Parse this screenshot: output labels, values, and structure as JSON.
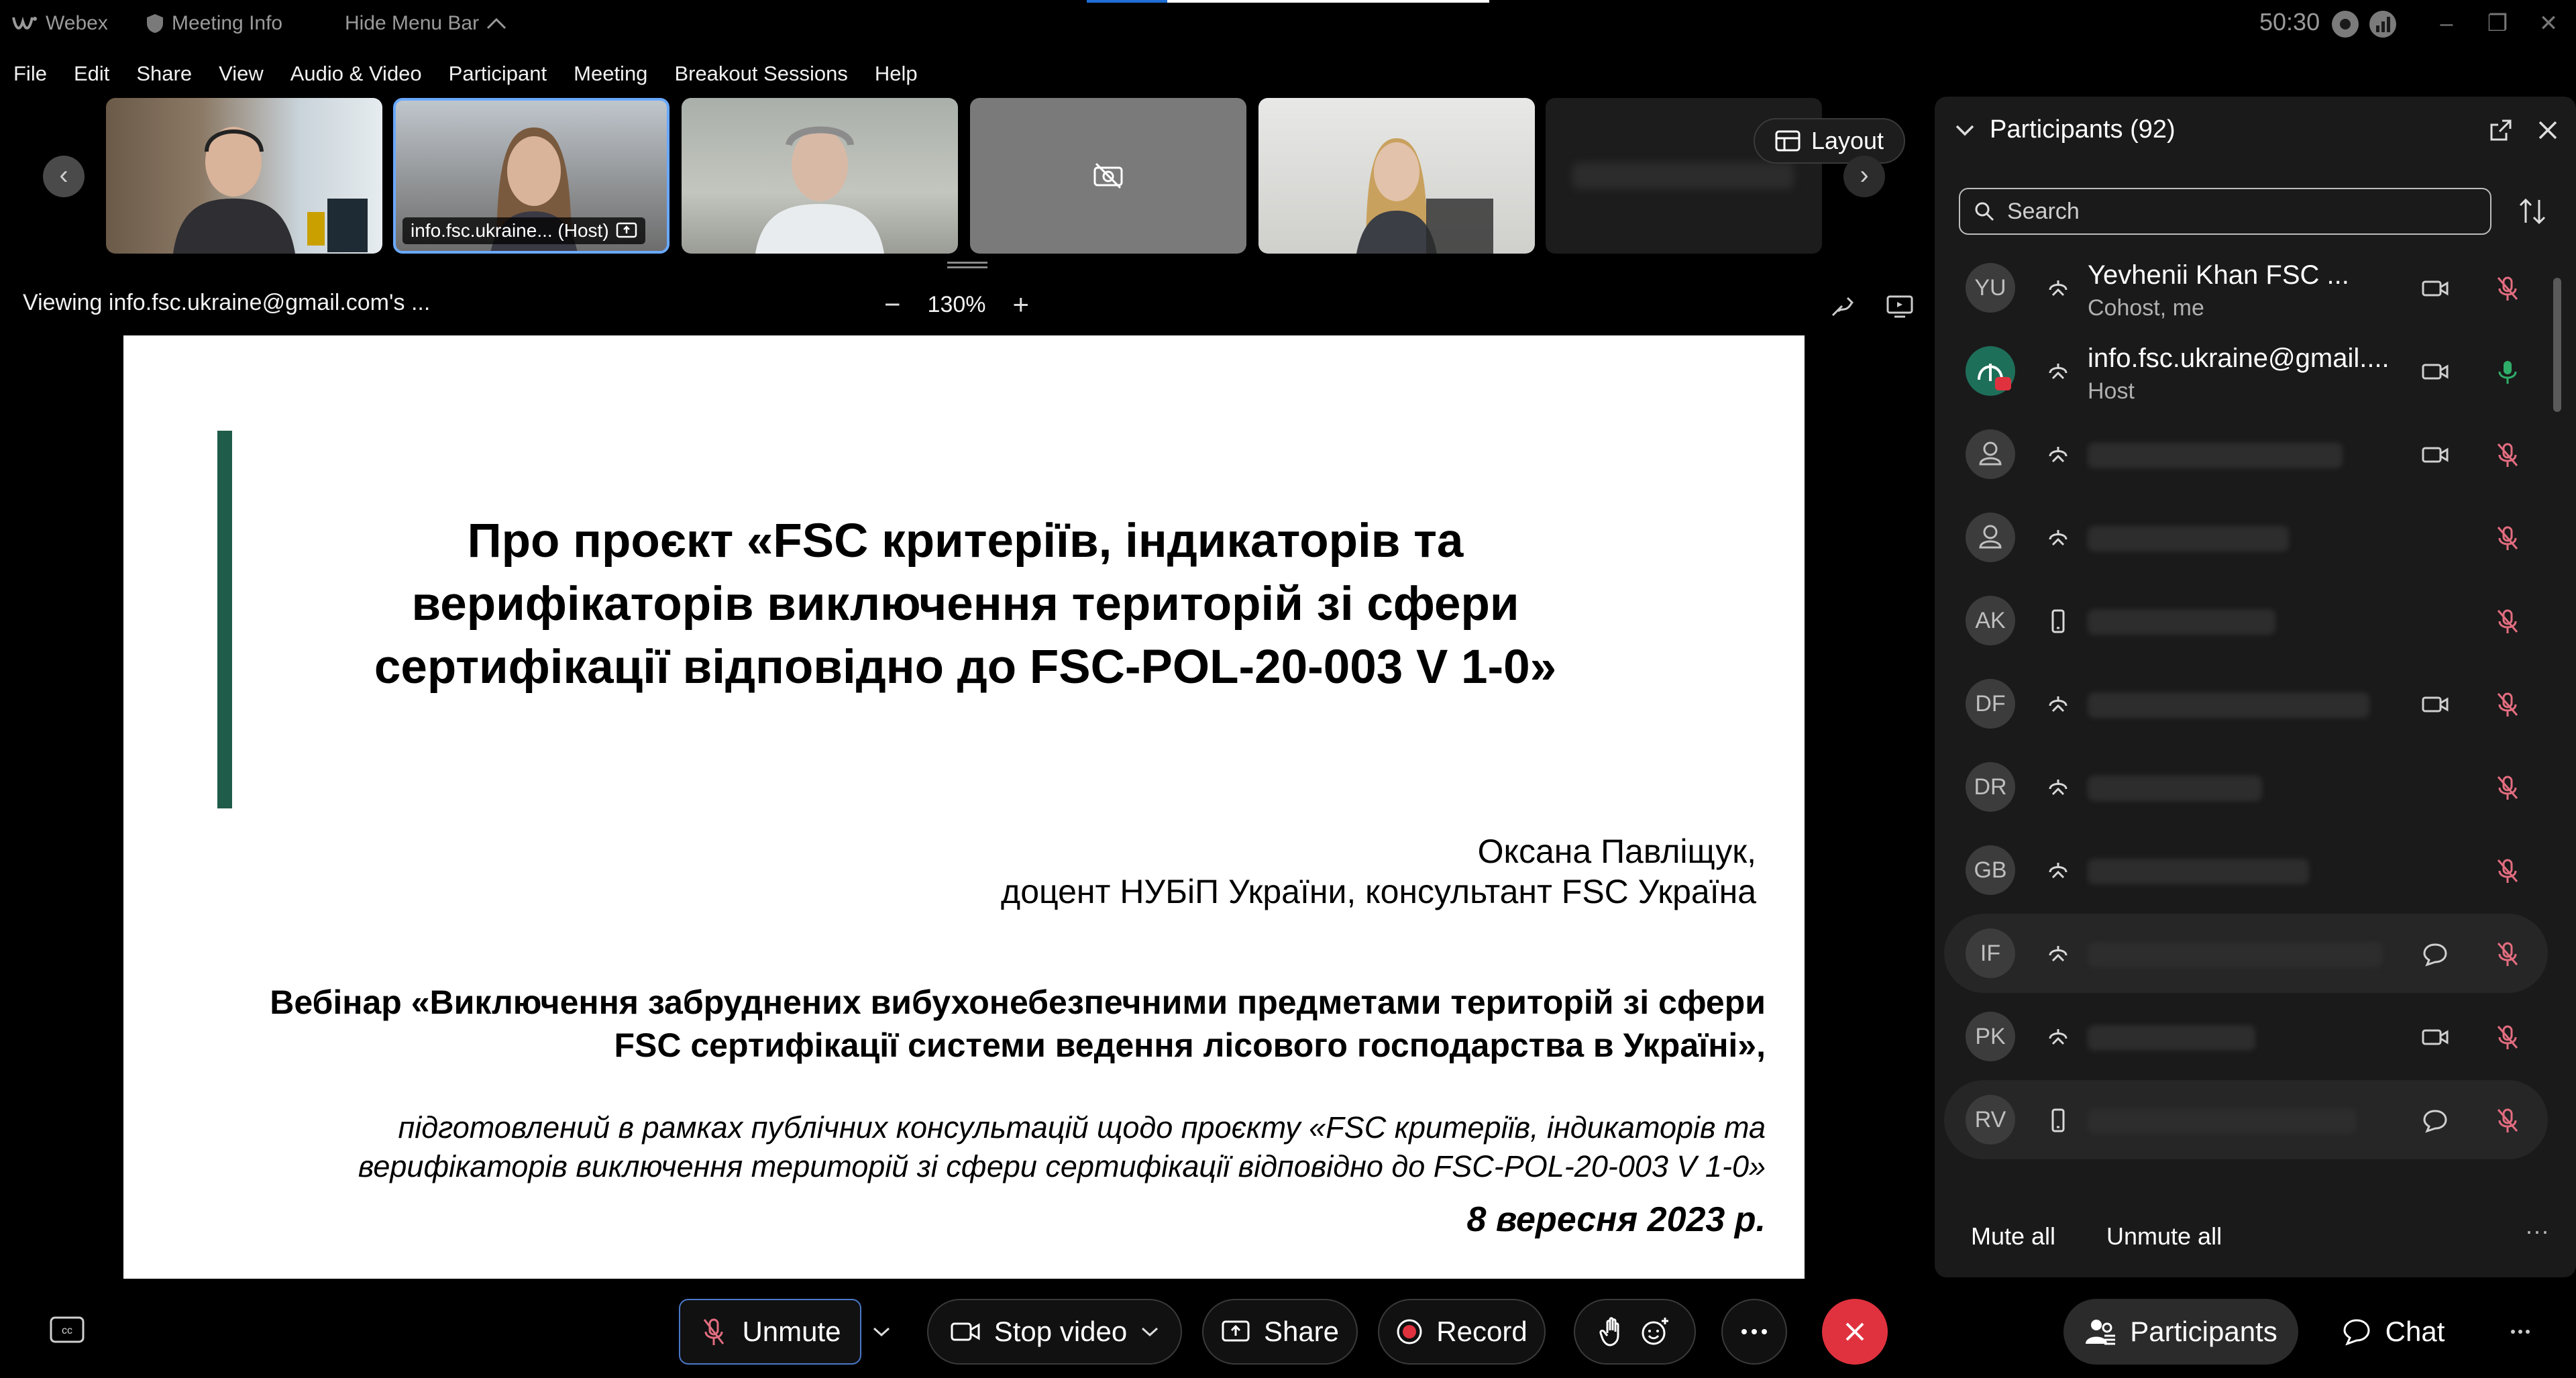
{
  "titlebar": {
    "app_name": "Webex",
    "meeting_info": "Meeting Info",
    "hide_menu": "Hide Menu Bar",
    "timer": "50:30"
  },
  "menu": [
    "File",
    "Edit",
    "Share",
    "View",
    "Audio & Video",
    "Participant",
    "Meeting",
    "Breakout Sessions",
    "Help"
  ],
  "filmstrip": {
    "host_label": "info.fsc.ukraine... (Host)",
    "layout_label": "Layout"
  },
  "viewbar": {
    "viewing_text": "Viewing info.fsc.ukraine@gmail.com's ...",
    "zoom_level": "130%",
    "zoom_minus": "−",
    "zoom_plus": "+"
  },
  "slide": {
    "title_line1": "Про проєкт «FSC критеріїв, індикаторів та",
    "title_line2": "верифікаторів виключення територій зі сфери",
    "title_line3": "сертифікації відповідно до FSC-POL-20-003 V 1-0»",
    "author_name": "Оксана Павліщук,",
    "author_position": "доцент НУБіП України, консультант FSC Україна",
    "webinar_line1": "Вебінар «Виключення забруднених вибухонебезпечними предметами територій зі сфери",
    "webinar_line2": "FSC сертифікації системи ведення лісового господарства в Україні»,",
    "prepared_line1": "підготовлений в рамках публічних консультацій щодо проєкту «FSC критеріїв, індикаторів та",
    "prepared_line2": "верифікаторів виключення територій зі сфери сертифікації відповідно до FSC-POL-20-003 V 1-0»",
    "date": "8 вересня 2023 р.",
    "accent_color": "#1f5c4a"
  },
  "panel": {
    "title": "Participants (92)",
    "search_placeholder": "Search",
    "participants": [
      {
        "initials": "YU",
        "name": "Yevhenii Khan FSC ...",
        "role": "Cohost, me",
        "video": true,
        "mic": "muted"
      },
      {
        "initials": "",
        "name": "info.fsc.ukraine@gmail....",
        "role": "Host",
        "video": true,
        "mic": "on"
      },
      {
        "initials": "",
        "name": "",
        "role": "",
        "video": true,
        "mic": "muted"
      },
      {
        "initials": "",
        "name": "",
        "role": "",
        "video": false,
        "mic": "muted"
      },
      {
        "initials": "AK",
        "name": "",
        "role": "",
        "video": false,
        "mic": "muted"
      },
      {
        "initials": "DF",
        "name": "",
        "role": "",
        "video": true,
        "mic": "muted"
      },
      {
        "initials": "DR",
        "name": "",
        "role": "",
        "video": false,
        "mic": "muted"
      },
      {
        "initials": "GB",
        "name": "",
        "role": "",
        "video": false,
        "mic": "muted"
      },
      {
        "initials": "IF",
        "name": "",
        "role": "",
        "video": false,
        "mic": "muted"
      },
      {
        "initials": "PK",
        "name": "",
        "role": "",
        "video": true,
        "mic": "muted"
      },
      {
        "initials": "RV",
        "name": "",
        "role": "",
        "video": false,
        "mic": "muted"
      }
    ],
    "mute_all": "Mute all",
    "unmute_all": "Unmute all"
  },
  "toolbar": {
    "unmute": "Unmute",
    "stop_video": "Stop video",
    "share": "Share",
    "record": "Record",
    "participants": "Participants",
    "chat": "Chat"
  },
  "colors": {
    "muted_mic": "#e36d80",
    "active_mic": "#2fae6a",
    "leave": "#e0323e",
    "focus": "#4a78c8"
  }
}
